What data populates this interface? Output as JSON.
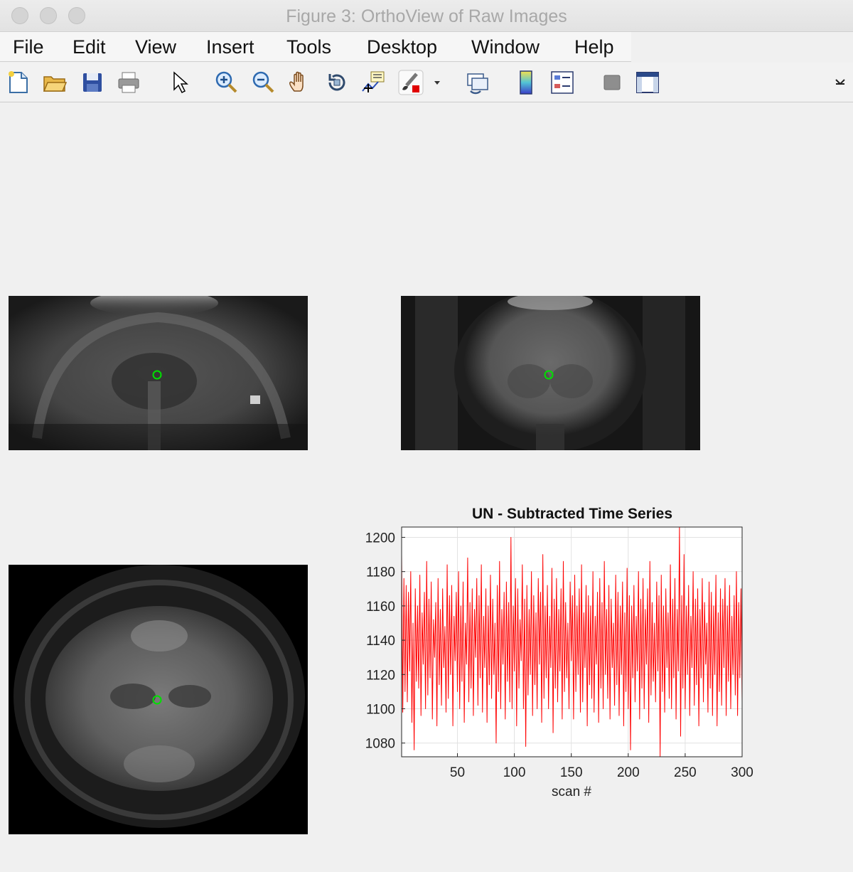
{
  "window": {
    "title": "Figure 3: OrthoView of Raw Images"
  },
  "menu": {
    "items": [
      "File",
      "Edit",
      "View",
      "Insert",
      "Tools",
      "Desktop",
      "Window",
      "Help"
    ]
  },
  "toolbar": {
    "icons": [
      "new-figure-icon",
      "open-file-icon",
      "save-icon",
      "print-icon",
      "edit-plot-arrow-icon",
      "zoom-in-icon",
      "zoom-out-icon",
      "pan-hand-icon",
      "rotate-3d-icon",
      "data-cursor-icon",
      "brush-icon",
      "brush-dropdown-icon",
      "link-plot-icon",
      "colorbar-icon",
      "legend-icon",
      "hide-plot-tools-icon",
      "show-plot-tools-icon",
      "toolbar-overflow-icon"
    ]
  },
  "views": {
    "sagittal": {
      "name": "sagittal-view",
      "cursor_color": "#00e000"
    },
    "coronal": {
      "name": "coronal-view",
      "cursor_color": "#00e000"
    },
    "axial": {
      "name": "axial-view",
      "cursor_color": "#00e000"
    }
  },
  "chart_data": {
    "type": "line",
    "title": "UN - Subtracted Time Series",
    "xlabel": "scan #",
    "ylabel": "",
    "xlim": [
      1,
      300
    ],
    "ylim": [
      1072,
      1206
    ],
    "xticks": [
      50,
      100,
      150,
      200,
      250,
      300
    ],
    "yticks": [
      1080,
      1100,
      1120,
      1140,
      1160,
      1180,
      1200
    ],
    "grid": true,
    "series_color": "#ff0000",
    "series": [
      {
        "x_start": 1,
        "x_step": 1,
        "values": [
          1190,
          1098,
          1176,
          1110,
          1172,
          1104,
          1168,
          1122,
          1180,
          1092,
          1150,
          1076,
          1170,
          1116,
          1160,
          1112,
          1178,
          1096,
          1156,
          1126,
          1168,
          1100,
          1186,
          1108,
          1164,
          1118,
          1174,
          1094,
          1152,
          1130,
          1162,
          1090,
          1176,
          1114,
          1158,
          1102,
          1170,
          1124,
          1148,
          1098,
          1184,
          1106,
          1166,
          1120,
          1172,
          1090,
          1154,
          1128,
          1168,
          1110,
          1180,
          1100,
          1160,
          1116,
          1174,
          1092,
          1150,
          1126,
          1188,
          1104,
          1162,
          1112,
          1170,
          1096,
          1158,
          1130,
          1176,
          1102,
          1166,
          1118,
          1184,
          1098,
          1154,
          1124,
          1170,
          1092,
          1160,
          1114,
          1178,
          1106,
          1164,
          1120,
          1150,
          1080,
          1172,
          1110,
          1186,
          1100,
          1158,
          1126,
          1168,
          1094,
          1174,
          1116,
          1162,
          1104,
          1200,
          1100,
          1160,
          1122,
          1176,
          1090,
          1170,
          1112,
          1152,
          1128,
          1184,
          1100,
          1164,
          1078,
          1172,
          1108,
          1158,
          1120,
          1180,
          1096,
          1166,
          1114,
          1156,
          1100,
          1176,
          1126,
          1168,
          1092,
          1190,
          1106,
          1160,
          1118,
          1172,
          1100,
          1154,
          1124,
          1182,
          1086,
          1164,
          1112,
          1176,
          1104,
          1158,
          1122,
          1170,
          1094,
          1186,
          1110,
          1162,
          1118,
          1150,
          1100,
          1174,
          1128,
          1166,
          1094,
          1178,
          1110,
          1160,
          1120,
          1170,
          1098,
          1184,
          1104,
          1156,
          1124,
          1172,
          1090,
          1166,
          1114,
          1160,
          1106,
          1180,
          1098,
          1154,
          1126,
          1168,
          1092,
          1176,
          1112,
          1162,
          1100,
          1186,
          1120,
          1158,
          1106,
          1172,
          1094,
          1164,
          1124,
          1150,
          1102,
          1178,
          1114,
          1168,
          1096,
          1160,
          1120,
          1174,
          1090,
          1156,
          1110,
          1182,
          1100,
          1166,
          1076,
          1160,
          1118,
          1172,
          1104,
          1154,
          1122,
          1180,
          1094,
          1164,
          1112,
          1176,
          1100,
          1158,
          1126,
          1170,
          1092,
          1186,
          1108,
          1162,
          1116,
          1150,
          1104,
          1174,
          1122,
          1166,
          1072,
          1178,
          1110,
          1160,
          1098,
          1170,
          1124,
          1156,
          1106,
          1184,
          1100,
          1164,
          1118,
          1176,
          1094,
          1158,
          1122,
          1206,
          1084,
          1166,
          1112,
          1190,
          1100,
          1160,
          1120,
          1172,
          1096,
          1154,
          1124,
          1180,
          1102,
          1164,
          1114,
          1170,
          1090,
          1158,
          1118,
          1176,
          1104,
          1162,
          1126,
          1150,
          1098,
          1174,
          1112,
          1168,
          1096,
          1160,
          1120,
          1178,
          1090,
          1156,
          1110,
          1170,
          1102,
          1164,
          1124,
          1176,
          1096,
          1160,
          1116,
          1172,
          1100,
          1154,
          1120,
          1166,
          1108,
          1180,
          1096,
          1162,
          1118,
          1170,
          1104
        ]
      }
    ]
  }
}
